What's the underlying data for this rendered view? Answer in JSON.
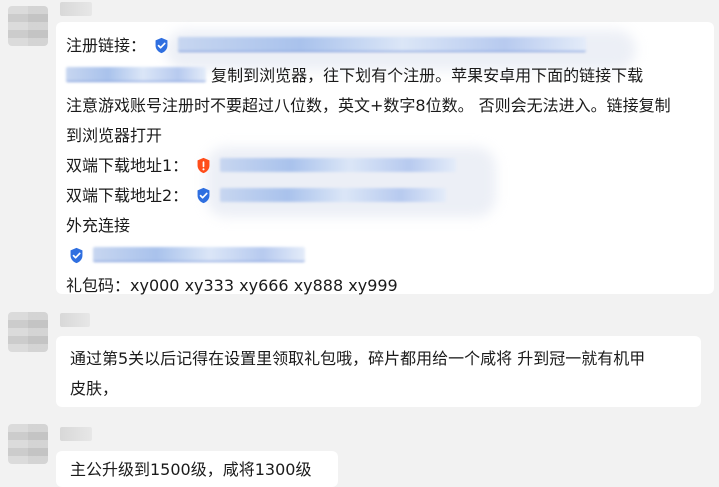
{
  "messages": [
    {
      "lines": [
        {
          "label": "注册链接："
        },
        {
          "tail": "复制到浏览器，往下划有个注册。苹果安卓用下面的链接下载"
        },
        {
          "text": "注意游戏账号注册时不要超过八位数，英文+数字8位数。 否则会无法进入。链接复制"
        },
        {
          "text": "到浏览器打开"
        },
        {
          "label": "双端下载地址1："
        },
        {
          "label": "双端下载地址2："
        },
        {
          "text": "外充连接"
        },
        {
          "text": ""
        },
        {
          "text": "礼包码：xy000 xy333 xy666 xy888 xy999"
        }
      ]
    },
    {
      "lines": [
        {
          "text": "通过第5关以后记得在设置里领取礼包哦，碎片都用给一个咸将  升到冠一就有机甲"
        },
        {
          "text": "皮肤，"
        }
      ]
    },
    {
      "lines": [
        {
          "text": "主公升级到1500级，咸将1300级"
        }
      ]
    }
  ],
  "icons": {
    "shield": "shield-check-icon",
    "warning": "warning-shield-icon"
  },
  "colors": {
    "background": "#f2f2f2",
    "bubble": "#ffffff",
    "shield_blue": "#2f6fe0",
    "warning_orange": "#ff4d1a",
    "link_blur": "#a9c2ec"
  }
}
